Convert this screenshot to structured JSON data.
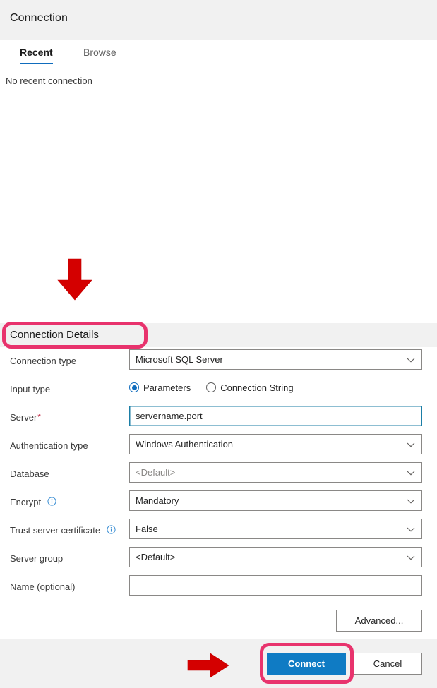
{
  "window": {
    "title": "Connection"
  },
  "tabs": [
    {
      "label": "Recent",
      "active": true
    },
    {
      "label": "Browse",
      "active": false
    }
  ],
  "recent_panel": {
    "empty_text": "No recent connection"
  },
  "details_section": {
    "title": "Connection Details",
    "fields": [
      {
        "label": "Connection type",
        "type": "dropdown",
        "value": "Microsoft SQL Server",
        "placeholder_style": false,
        "required": false,
        "info": false
      },
      {
        "label": "Input type",
        "type": "radiogroup",
        "options": [
          {
            "label": "Parameters",
            "selected": true
          },
          {
            "label": "Connection String",
            "selected": false
          }
        ]
      },
      {
        "label": "Server",
        "type": "textbox",
        "value": "servername.port",
        "placeholder": "",
        "required": true,
        "required_marker": "*",
        "focused": true,
        "info": false
      },
      {
        "label": "Authentication type",
        "type": "dropdown",
        "value": "Windows Authentication",
        "placeholder_style": false,
        "required": false,
        "info": false
      },
      {
        "label": "Database",
        "type": "dropdown",
        "value": "<Default>",
        "placeholder_style": true,
        "required": false,
        "info": false
      },
      {
        "label": "Encrypt",
        "type": "dropdown",
        "value": "Mandatory",
        "placeholder_style": false,
        "required": false,
        "info": true
      },
      {
        "label": "Trust server certificate",
        "type": "dropdown",
        "value": "False",
        "placeholder_style": false,
        "required": false,
        "info": true
      },
      {
        "label": "Server group",
        "type": "dropdown",
        "value": "<Default>",
        "placeholder_style": false,
        "required": false,
        "info": false
      },
      {
        "label": "Name (optional)",
        "type": "textbox",
        "value": "",
        "placeholder": "",
        "required": false,
        "focused": false,
        "info": false
      }
    ],
    "advanced_button": "Advanced..."
  },
  "footer": {
    "connect_label": "Connect",
    "cancel_label": "Cancel"
  },
  "annotations": {
    "highlight_color": "#e8336d",
    "arrow_color": "#d40000",
    "arrow_down_target": "Connection Details",
    "arrow_right_target": "Connect"
  },
  "colors": {
    "header_background": "#f1f1f1",
    "accent_blue": "#0f6cbd",
    "primary_button": "#0f7bc4",
    "focus_border": "#1b7ea6",
    "required_asterisk": "#c4314b",
    "info_icon": "#0f6cbd"
  },
  "icons": {
    "chevron_down": "chevron-down-icon",
    "info": "info-icon",
    "radio_selected": "radio-selected-icon",
    "radio_unselected": "radio-unselected-icon"
  }
}
